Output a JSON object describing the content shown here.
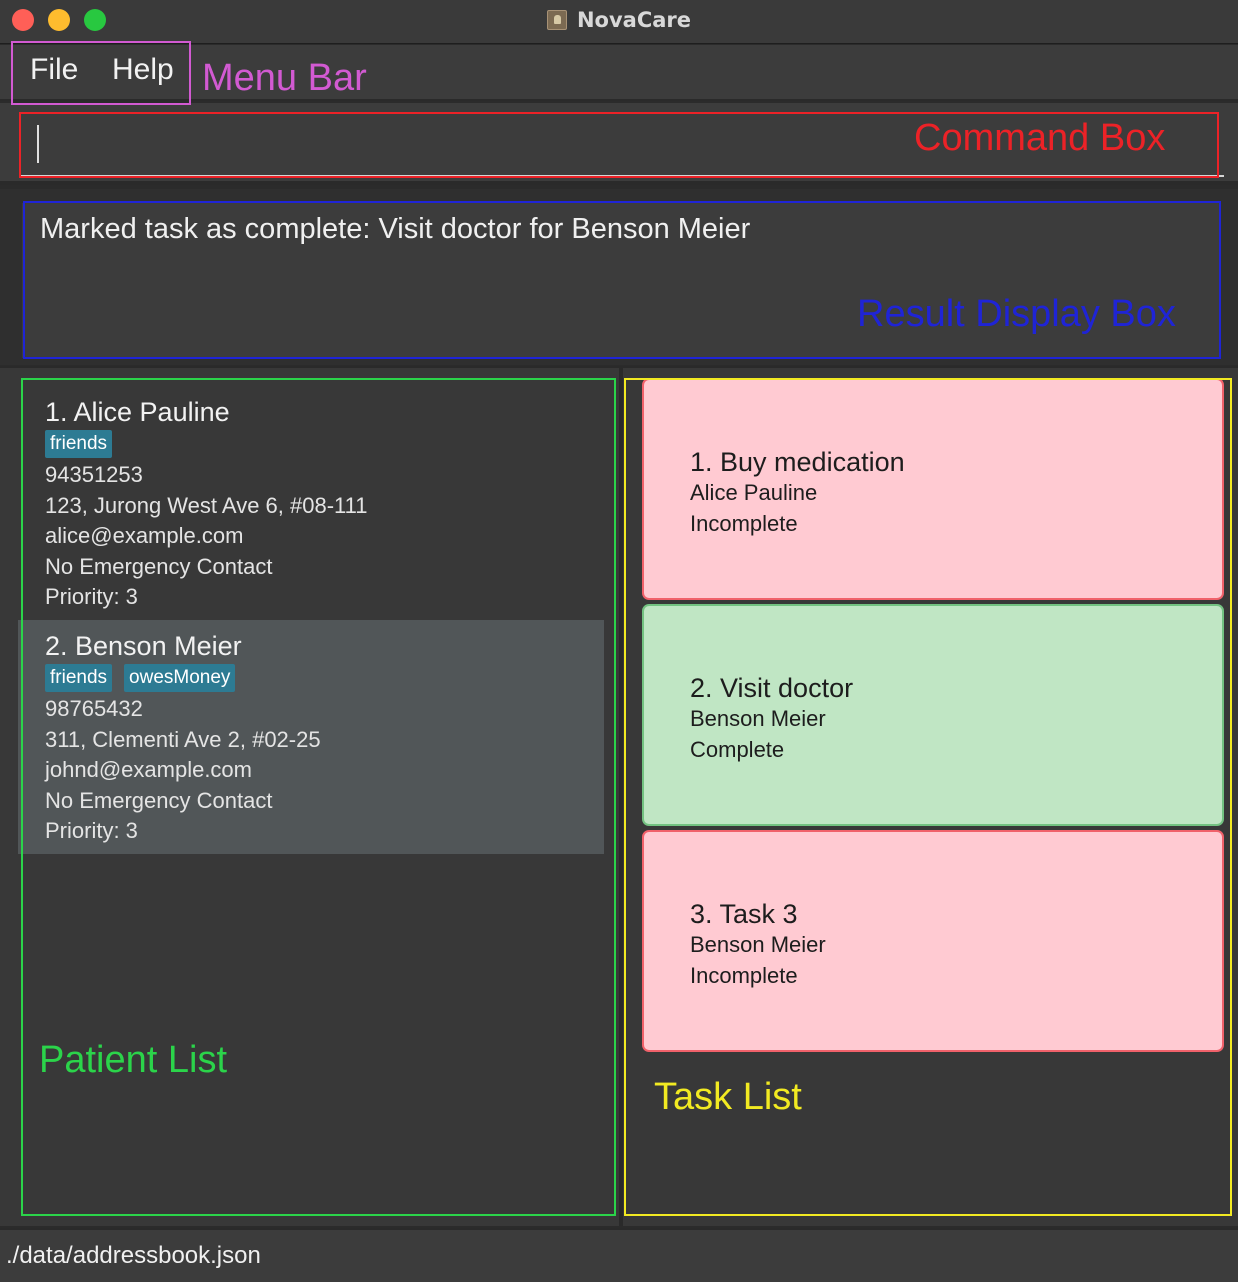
{
  "window": {
    "title": "NovaCare",
    "icon": "app-icon"
  },
  "menu": {
    "file_label": "File",
    "help_label": "Help"
  },
  "command_box": {
    "value": ""
  },
  "result_display": {
    "text": "Marked task as complete: Visit doctor for Benson Meier"
  },
  "patients": [
    {
      "name": "1. Alice Pauline",
      "tags": [
        "friends"
      ],
      "phone": "94351253",
      "address": "123, Jurong West Ave 6, #08-111",
      "email": "alice@example.com",
      "emergency_contact": "No Emergency Contact",
      "priority": "Priority: 3"
    },
    {
      "name": "2. Benson Meier",
      "tags": [
        "friends",
        "owesMoney"
      ],
      "phone": "98765432",
      "address": "311, Clementi Ave 2, #02-25",
      "email": "johnd@example.com",
      "emergency_contact": "No Emergency Contact",
      "priority": "Priority: 3"
    }
  ],
  "tasks": [
    {
      "title": "1. Buy medication",
      "patient": "Alice Pauline",
      "status": "Incomplete"
    },
    {
      "title": "2. Visit doctor",
      "patient": "Benson Meier",
      "status": "Complete"
    },
    {
      "title": "3. Task 3",
      "patient": "Benson Meier",
      "status": "Incomplete"
    }
  ],
  "status_bar": {
    "file_path": "./data/addressbook.json"
  },
  "annotations": {
    "menu_bar": "Menu Bar",
    "command_box": "Command Box",
    "result_display_box": "Result Display Box",
    "patient_list": "Patient List",
    "task_list": "Task List"
  },
  "colors": {
    "annotation_menu_bar": "#d25ad2",
    "annotation_command_box": "#ec2227",
    "annotation_result_display_box": "#1f24d6",
    "annotation_patient_list": "#2bd44a",
    "annotation_task_list": "#f2ea22",
    "task_incomplete_bg": "#ffcad2",
    "task_complete_bg": "#c0e6c4",
    "tag_bg": "#2d7b93"
  }
}
